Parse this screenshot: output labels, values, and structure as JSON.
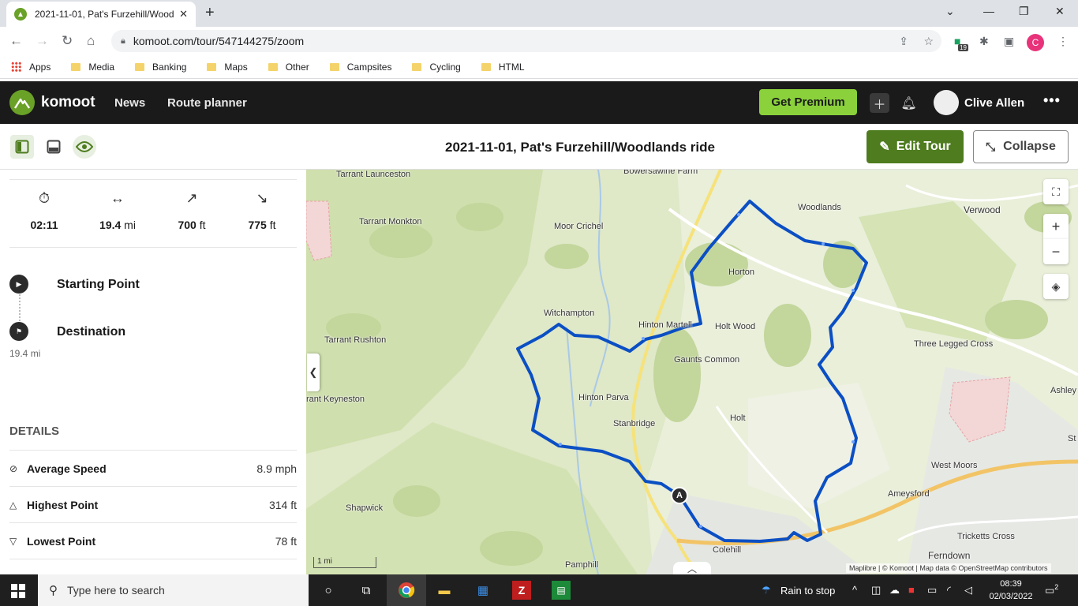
{
  "browser": {
    "tab_title": "2021-11-01, Pat's Furzehill/Woodlands ride",
    "url": "komoot.com/tour/547144275/zoom",
    "bookmarks": [
      "Apps",
      "Media",
      "Banking",
      "Maps",
      "Other",
      "Campsites",
      "Cycling",
      "HTML"
    ],
    "profile_initial": "C",
    "ext_badge": "19"
  },
  "header": {
    "brand": "komoot",
    "nav": [
      "News",
      "Route planner"
    ],
    "premium_label": "Get Premium",
    "user_name": "Clive Allen"
  },
  "tour": {
    "title": "2021-11-01, Pat's Furzehill/Woodlands ride",
    "edit_label": "Edit Tour",
    "collapse_label": "Collapse"
  },
  "stats": {
    "duration": "02:11",
    "distance_value": "19.4",
    "distance_unit": "mi",
    "uphill_value": "700",
    "uphill_unit": "ft",
    "downhill_value": "775",
    "downhill_unit": "ft"
  },
  "waypoints": {
    "start_label": "Starting Point",
    "destination_label": "Destination",
    "destination_distance": "19.4 mi"
  },
  "details": {
    "title": "DETAILS",
    "rows": [
      {
        "label": "Average Speed",
        "value": "8.9 mph"
      },
      {
        "label": "Highest Point",
        "value": "314 ft"
      },
      {
        "label": "Lowest Point",
        "value": "78 ft"
      }
    ]
  },
  "map": {
    "places": [
      "Tarrant Launceston",
      "Bowersawine Farm",
      "Woodlands",
      "Verwood",
      "Tarrant Monkton",
      "Moor Crichel",
      "Horton",
      "Witchampton",
      "Hinton Martell",
      "Holt Wood",
      "Tarrant Rushton",
      "Three Legged Cross",
      "Gaunts Common",
      "Ashley",
      "Hinton Parva",
      "rant Keyneston",
      "Holt",
      "Stanbridge",
      "St",
      "West Moors",
      "Ameysford",
      "Shapwick",
      "Tricketts Cross",
      "Colehill",
      "Ferndown",
      "Pamphill"
    ],
    "marker_label": "A",
    "scale_label": "1 mi",
    "attribution": "Maplibre | © Komoot | Map data © OpenStreetMap contributors",
    "route_color": "#0b4fc4"
  },
  "taskbar": {
    "search_placeholder": "Type here to search",
    "weather": "Rain to stop",
    "time": "08:39",
    "date": "02/03/2022",
    "notif_count": "2"
  }
}
